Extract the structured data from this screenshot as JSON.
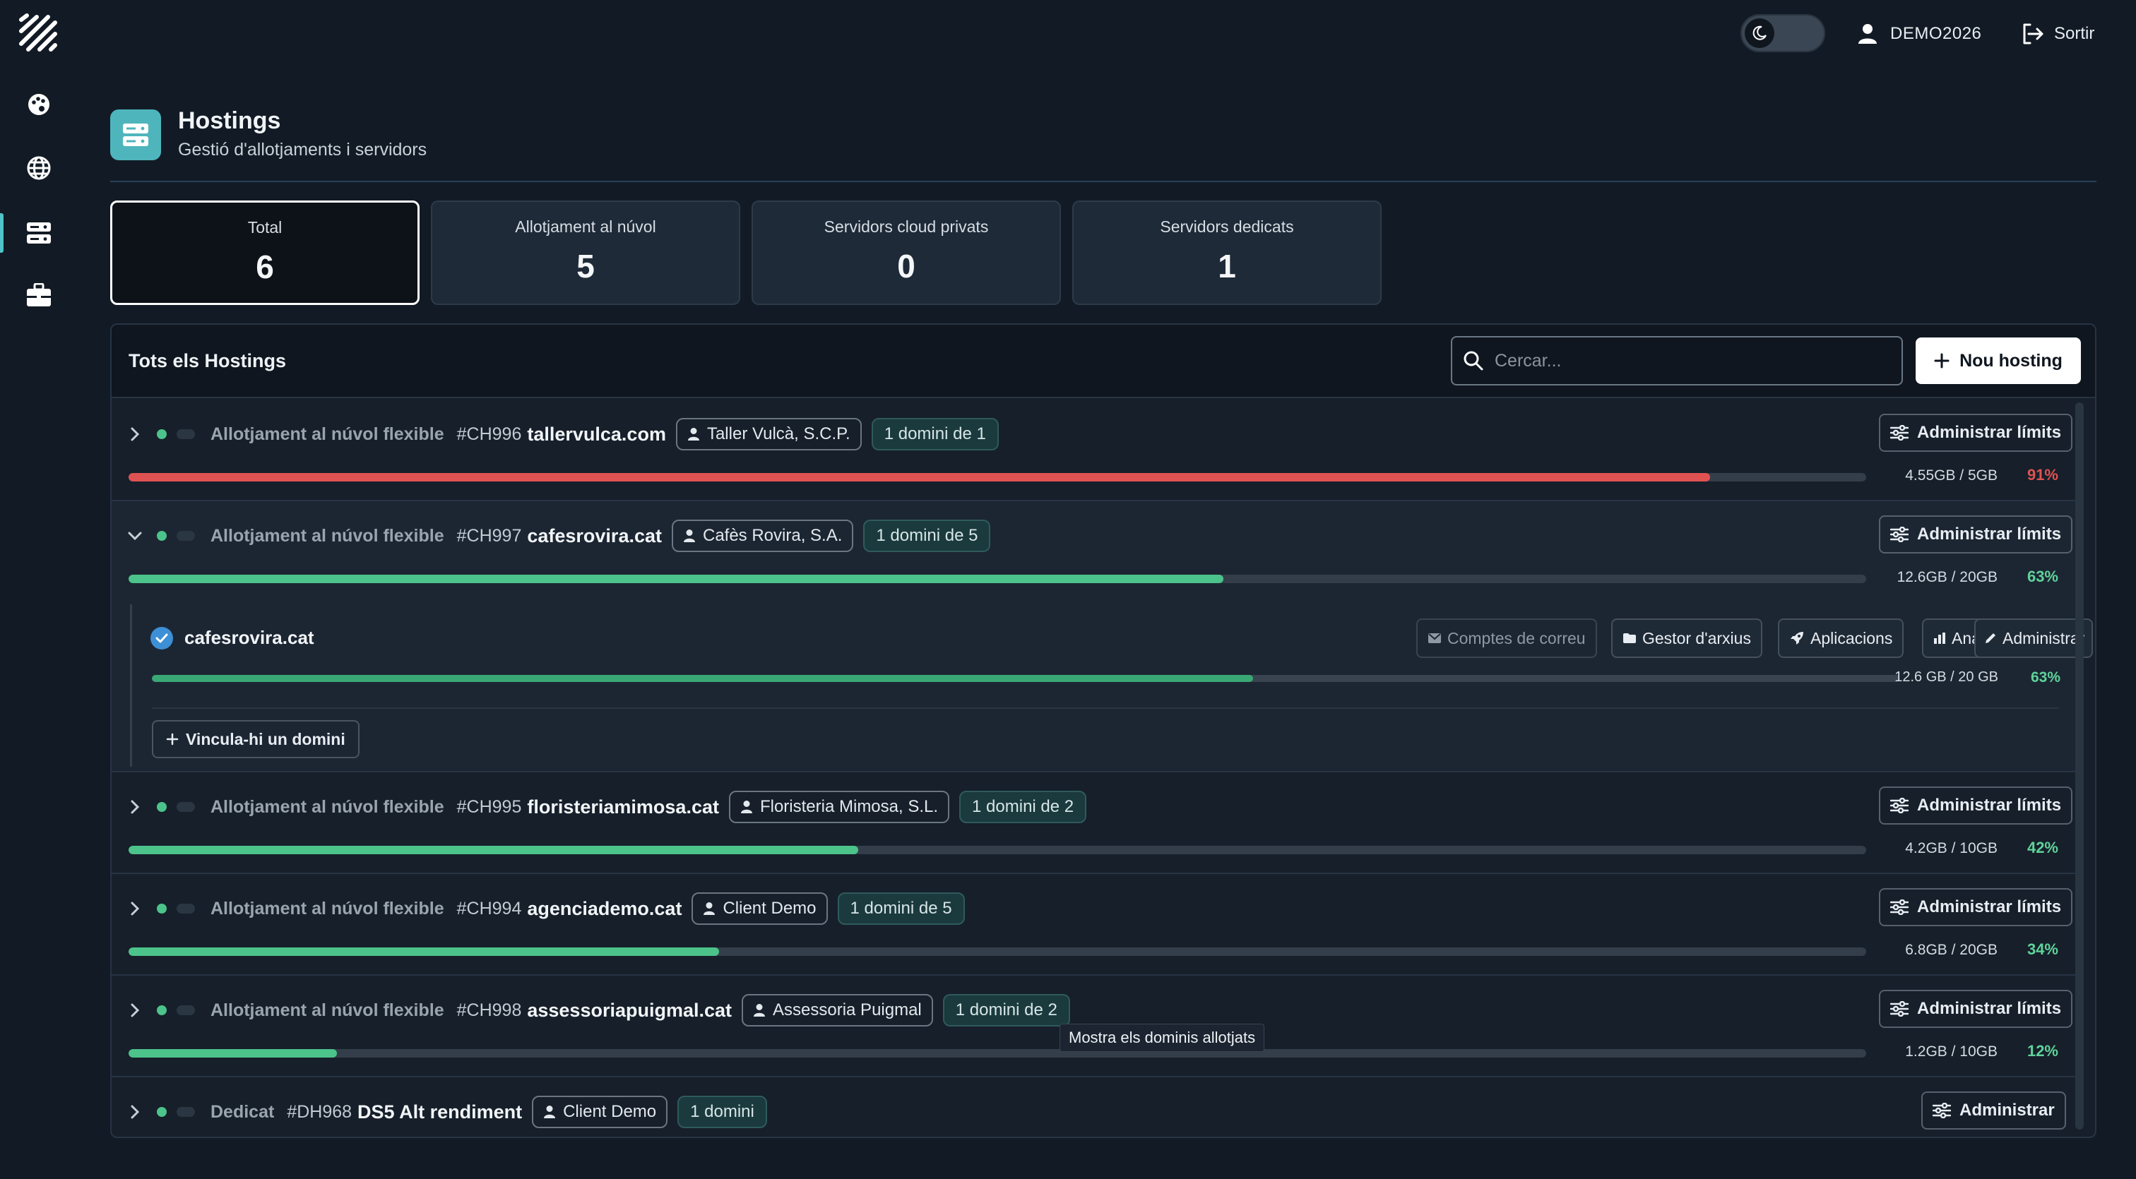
{
  "user": {
    "name": "DEMO2026",
    "logout_label": "Sortir"
  },
  "header": {
    "title": "Hostings",
    "subtitle": "Gestió d'allotjaments i servidors"
  },
  "stats": [
    {
      "label": "Total",
      "value": "6",
      "active": true
    },
    {
      "label": "Allotjament al núvol",
      "value": "5"
    },
    {
      "label": "Servidors cloud privats",
      "value": "0"
    },
    {
      "label": "Servidors dedicats",
      "value": "1"
    }
  ],
  "panel": {
    "title": "Tots els Hostings",
    "search_placeholder": "Cercar...",
    "new_button": "Nou hosting"
  },
  "rows": [
    {
      "type": "Allotjament al núvol flexible",
      "id": "#CH996",
      "domain": "tallervulca.com",
      "client": "Taller Vulcà, S.C.P.",
      "domains": "1 domini de 1",
      "action": "Administrar límits",
      "usage": "4.55GB / 5GB",
      "percent": "91%",
      "fraction": 0.91,
      "color": "#e05252"
    },
    {
      "type": "Allotjament al núvol flexible",
      "id": "#CH997",
      "domain": "cafesrovira.cat",
      "client": "Cafès Rovira, S.A.",
      "domains": "1 domini de 5",
      "action": "Administrar límits",
      "usage": "12.6GB / 20GB",
      "percent": "63%",
      "fraction": 0.63,
      "color": "#4cc38a",
      "expanded": true
    },
    {
      "type": "Allotjament al núvol flexible",
      "id": "#CH995",
      "domain": "floristeriamimosa.cat",
      "client": "Floristeria Mimosa, S.L.",
      "domains": "1 domini de 2",
      "action": "Administrar límits",
      "usage": "4.2GB / 10GB",
      "percent": "42%",
      "fraction": 0.42,
      "color": "#4cc38a"
    },
    {
      "type": "Allotjament al núvol flexible",
      "id": "#CH994",
      "domain": "agenciademo.cat",
      "client": "Client Demo",
      "domains": "1 domini de 5",
      "action": "Administrar límits",
      "usage": "6.8GB / 20GB",
      "percent": "34%",
      "fraction": 0.34,
      "color": "#4cc38a"
    },
    {
      "type": "Allotjament al núvol flexible",
      "id": "#CH998",
      "domain": "assessoriapuigmal.cat",
      "client": "Assessoria Puigmal",
      "domains": "1 domini de 2",
      "action": "Administrar límits",
      "usage": "1.2GB / 10GB",
      "percent": "12%",
      "fraction": 0.12,
      "color": "#4cc38a"
    },
    {
      "type": "Dedicat",
      "id": "#DH968",
      "domain": "DS5 Alt rendiment",
      "client": "Client Demo",
      "domains": "1 domini",
      "action": "Administrar"
    }
  ],
  "expanded_domain": {
    "name": "cafesrovira.cat",
    "buttons": {
      "mail": "Comptes de correu",
      "files": "Gestor d'arxius",
      "apps": "Aplicacions",
      "analytics": "Analítica",
      "admin": "Administrar"
    },
    "usage": "12.6 GB / 20 GB",
    "percent": "63%",
    "fraction": 0.63,
    "link_label": "Vincula-hi un domini"
  },
  "tooltip": "Mostra els dominis allotjats"
}
